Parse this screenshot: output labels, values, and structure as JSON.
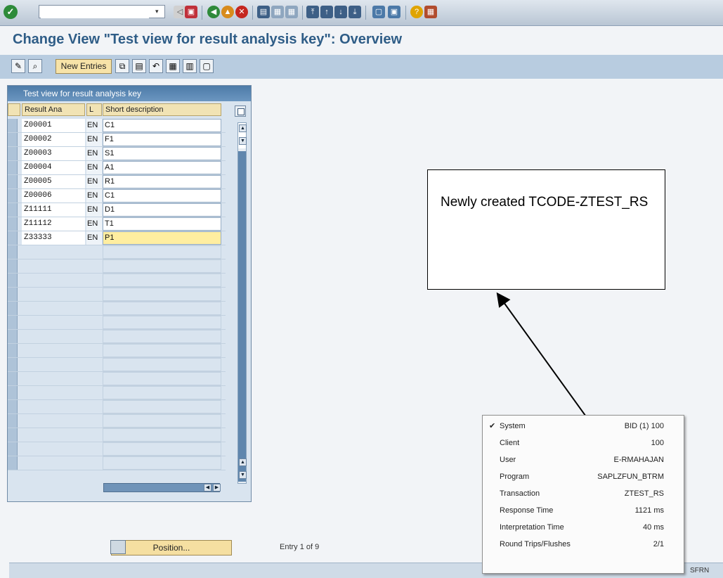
{
  "title": "Change View \"Test view for result analysis key\": Overview",
  "toolbar": {
    "command_value": "",
    "new_entries_label": "New Entries"
  },
  "table": {
    "title": "Test view for result analysis key",
    "columns": [
      "Result Ana",
      "L",
      "Short description"
    ],
    "rows": [
      {
        "key": "Z00001",
        "lang": "EN",
        "desc": "C1"
      },
      {
        "key": "Z00002",
        "lang": "EN",
        "desc": "F1"
      },
      {
        "key": "Z00003",
        "lang": "EN",
        "desc": "S1"
      },
      {
        "key": "Z00004",
        "lang": "EN",
        "desc": "A1"
      },
      {
        "key": "Z00005",
        "lang": "EN",
        "desc": "R1"
      },
      {
        "key": "Z00006",
        "lang": "EN",
        "desc": "C1"
      },
      {
        "key": "Z11111",
        "lang": "EN",
        "desc": "D1"
      },
      {
        "key": "Z11112",
        "lang": "EN",
        "desc": "T1"
      },
      {
        "key": "Z33333",
        "lang": "EN",
        "desc": "P1"
      }
    ]
  },
  "footer": {
    "position_label": "Position...",
    "entry_info": "Entry 1 of 9"
  },
  "callout": {
    "text": "Newly created TCODE-ZTEST_RS"
  },
  "status_popup": {
    "items": [
      {
        "label": "System",
        "value": "BID (1) 100"
      },
      {
        "label": "Client",
        "value": "100"
      },
      {
        "label": "User",
        "value": "E-RMAHAJAN"
      },
      {
        "label": "Program",
        "value": "SAPLZFUN_BTRM"
      },
      {
        "label": "Transaction",
        "value": "ZTEST_RS"
      },
      {
        "label": "Response Time",
        "value": "1121 ms"
      },
      {
        "label": "Interpretation Time",
        "value": "40 ms"
      },
      {
        "label": "Round Trips/Flushes",
        "value": "2/1"
      }
    ]
  },
  "statusbar": {
    "right_text": "SFRN"
  }
}
